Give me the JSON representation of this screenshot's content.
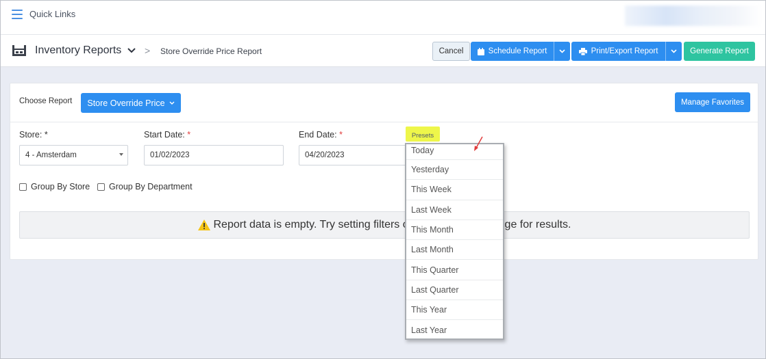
{
  "topbar": {
    "quick_links_label": "Quick Links"
  },
  "header": {
    "title": "Inventory Reports",
    "breadcrumb_separator": ">",
    "breadcrumb_current": "Store Override Price Report",
    "cancel_label": "Cancel",
    "schedule_label": "Schedule Report",
    "print_label": "Print/Export Report",
    "generate_label": "Generate Report"
  },
  "card": {
    "choose_report_label": "Choose Report",
    "report_button_label": "Store Override Price",
    "manage_favorites_label": "Manage Favorites",
    "store_label": "Store: *",
    "store_value": "4 - Amsterdam",
    "start_date_label": "Start Date:",
    "start_date_value": "01/02/2023",
    "end_date_label": "End Date:",
    "end_date_value": "04/20/2023",
    "required_marker": "*",
    "presets_label": "Presets",
    "group_by_store_label": "Group By Store",
    "group_by_department_label": "Group By Department",
    "empty_message_left": "Report data is empty. Try setting filters o",
    "empty_message_right": "nge for results."
  },
  "presets_menu": {
    "items": [
      "Today",
      "Yesterday",
      "This Week",
      "Last Week",
      "This Month",
      "Last Month",
      "This Quarter",
      "Last Quarter",
      "This Year",
      "Last Year"
    ]
  },
  "colors": {
    "primary": "#2d8ef0",
    "success": "#2ec4a0",
    "highlight": "#eef64a",
    "warning": "#f5c518",
    "required": "#e03c3c"
  }
}
